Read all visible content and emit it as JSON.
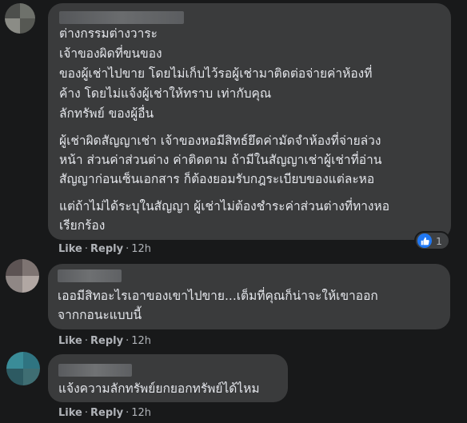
{
  "comments": [
    {
      "lines": [
        "ต่างกรรมต่างวาระ",
        "เจ้าของผิดที่ขนของ",
        "ของผู้เช่าไปขาย โดยไม่เก็บไว้รอผู้เช่ามาติดต่อจ่ายค่าห้องที่",
        "ค้าง โดยไม่แจ้งผู้เช่าให้ทราบ เท่ากับคุณ",
        "ลักทรัพย์ ของผู้อื่น",
        "ผู้เช่าผิดสัญญาเช่า เจ้าของหอมีสิทธ์ยึดค่ามัดจำห้องที่จ่ายล่วง",
        "หน้า ส่วนค่าส่วนต่าง ค่าติดตาม ถ้ามีในสัญญาเช่าผู้เช่าที่อ่าน",
        "สัญญาก่อนเซ็นเอกสาร ก็ต้องยอมรับกฎระเบียบของแต่ละหอ",
        "แต่ถ้าไม่ได้ระบุในสัญญา ผู้เช่าไม่ต้องชำระค่าส่วนต่างที่ทางหอ",
        "เรียกร้อง"
      ],
      "like": "Like",
      "reply": "Reply",
      "time": "12h",
      "reaction_count": "1"
    },
    {
      "lines": [
        "เออมีสิทอะไรเอาของเขาไปขาย...เต็มที่คุณก็น่าจะให้เขาออก",
        "จากกอนะแบบนี้"
      ],
      "like": "Like",
      "reply": "Reply",
      "time": "12h"
    },
    {
      "lines": [
        "แจ้งความลักทรัพย์ยกยอกทรัพย์ได้ไหม"
      ],
      "like": "Like",
      "reply": "Reply",
      "time": "12h"
    }
  ],
  "colors": {
    "background": "#18191a",
    "bubble": "#3a3b3c",
    "text": "#e4e6eb",
    "secondary_text": "#b0b3b8",
    "like_blue": "#2078f4"
  }
}
